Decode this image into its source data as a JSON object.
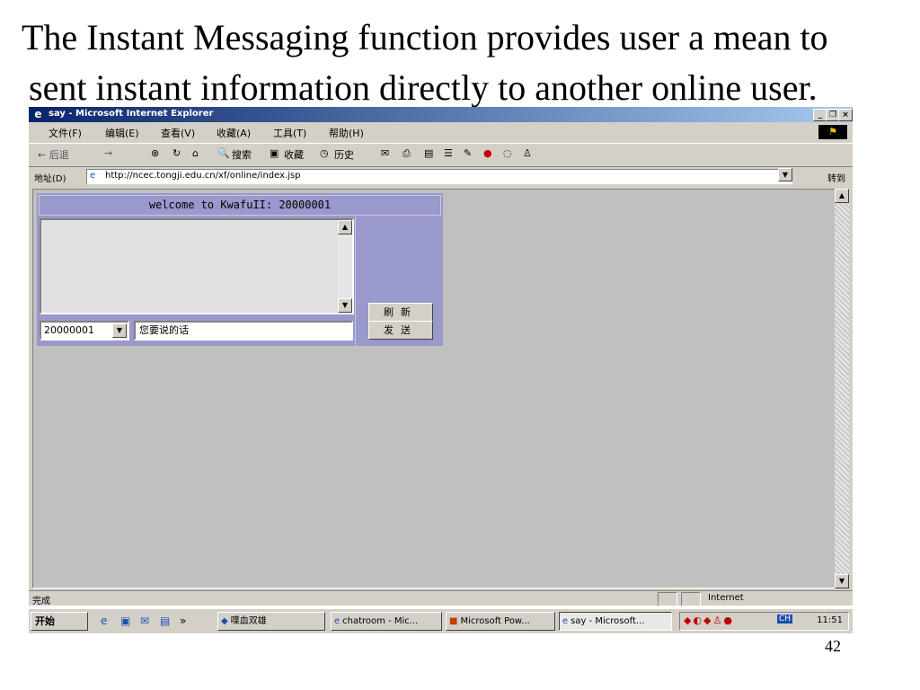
{
  "caption": {
    "line1": "The Instant Messaging function provides user a mean to",
    "line2": "sent instant information directly to another online user."
  },
  "window": {
    "title": "say - Microsoft Internet Explorer",
    "controls": [
      "_",
      "❒",
      "×"
    ]
  },
  "menu": [
    "文件(F)",
    "编辑(E)",
    "查看(V)",
    "收藏(A)",
    "工具(T)",
    "帮助(H)"
  ],
  "toolbar": {
    "back": "← 后退",
    "forward": "→",
    "stop": "⊗",
    "refresh": "↻",
    "home": "⌂",
    "search": "搜索",
    "favorites": "收藏",
    "history": "历史"
  },
  "address": {
    "label": "地址(D)",
    "url": "http://ncec.tongji.edu.cn/xf/online/index.jsp",
    "go": "转到"
  },
  "app": {
    "header": "welcome to KwafuII: 20000001",
    "user_select": "20000001",
    "message_input": "您要说的话",
    "refresh_button": "刷新",
    "send_button": "发送"
  },
  "status": {
    "left": "完成",
    "zone": "Internet"
  },
  "taskbar": {
    "start": "开始",
    "items": [
      "喋血双雄",
      "chatroom - Mic...",
      "Microsoft Pow...",
      "say - Microsoft..."
    ],
    "tray_lang": "CH",
    "clock": "11:51"
  },
  "page_number": "42"
}
